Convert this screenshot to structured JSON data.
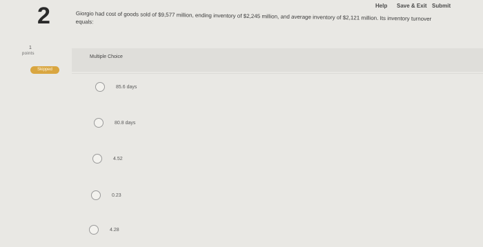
{
  "header": {
    "help": "Help",
    "save_exit": "Save & Exit",
    "submit": "Submit"
  },
  "question": {
    "number": "2",
    "text": "Giorgio had cost of goods sold of $9,577 million, ending inventory of $2,245 million, and average inventory of $2,121 million. Its inventory turnover equals:",
    "points_value": "1",
    "points_label": "points",
    "status": "Skipped",
    "type_label": "Multiple Choice"
  },
  "options": [
    {
      "label": "85.6 days"
    },
    {
      "label": "80.8 days"
    },
    {
      "label": "4.52"
    },
    {
      "label": "0.23"
    },
    {
      "label": "4.28"
    }
  ]
}
